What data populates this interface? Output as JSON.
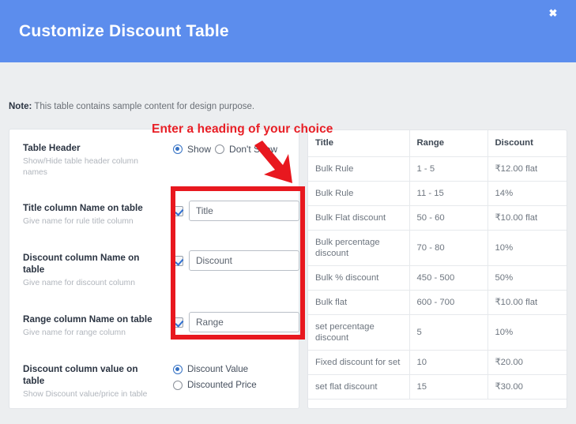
{
  "header": {
    "title": "Customize Discount Table",
    "close_label": "✖",
    "bg_color": "#5c8ded"
  },
  "note": {
    "prefix": "Note:",
    "text": " This table contains sample content for design purpose."
  },
  "annotation": {
    "heading": "Enter a heading of your choice",
    "color": "#e81f26"
  },
  "form": {
    "fields": [
      {
        "title": "Table Header",
        "subtitle": "Show/Hide table header column names",
        "type": "radio-inline",
        "options": [
          "Show",
          "Don't Show"
        ],
        "selected": "Show"
      },
      {
        "title": "Title column Name on table",
        "subtitle": "Give name for rule title column",
        "type": "checkbox-input",
        "checked": true,
        "value": "Title",
        "placeholder": "Title"
      },
      {
        "title": "Discount column Name on table",
        "subtitle": "Give name for discount column",
        "type": "checkbox-input",
        "checked": true,
        "value": "Discount",
        "placeholder": "Discount"
      },
      {
        "title": "Range column Name on table",
        "subtitle": "Give name for range column",
        "type": "checkbox-input",
        "checked": true,
        "value": "Range",
        "placeholder": "Range"
      },
      {
        "title": "Discount column value on table",
        "subtitle": "Show Discount value/price in table",
        "type": "radio-stack",
        "options": [
          "Discount Value",
          "Discounted Price"
        ],
        "selected": "Discount Value"
      }
    ]
  },
  "preview_table": {
    "columns": [
      "Title",
      "Range",
      "Discount"
    ],
    "rows": [
      [
        "Bulk Rule",
        "1 - 5",
        "₹12.00 flat"
      ],
      [
        "Bulk Rule",
        "11 - 15",
        "14%"
      ],
      [
        "Bulk Flat discount",
        "50 - 60",
        "₹10.00 flat"
      ],
      [
        "Bulk percentage discount",
        "70 - 80",
        "10%"
      ],
      [
        "Bulk % discount",
        "450 - 500",
        "50%"
      ],
      [
        "Bulk flat",
        "600 - 700",
        "₹10.00 flat"
      ],
      [
        "set percentage discount",
        "5",
        "10%"
      ],
      [
        "Fixed discount for set",
        "10",
        "₹20.00"
      ],
      [
        "set flat discount",
        "15",
        "₹30.00"
      ]
    ]
  }
}
